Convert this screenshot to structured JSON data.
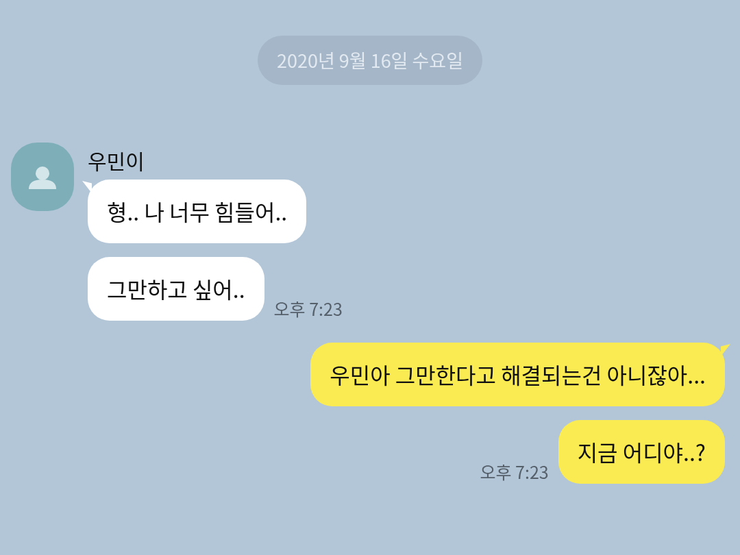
{
  "date_divider": "2020년 9월 16일 수요일",
  "groups": [
    {
      "kind": "received",
      "sender": "우민이",
      "time": "오후 7:23",
      "messages": [
        {
          "text": "형.. 나 너무 힘들어..",
          "tail": true
        },
        {
          "text": "그만하고 싶어..",
          "tail": false
        }
      ]
    },
    {
      "kind": "sent",
      "time": "오후 7:23",
      "messages": [
        {
          "text": "우민아 그만한다고 해결되는건 아니잖아...",
          "tail": true
        },
        {
          "text": "지금 어디야..?",
          "tail": false
        }
      ]
    }
  ]
}
